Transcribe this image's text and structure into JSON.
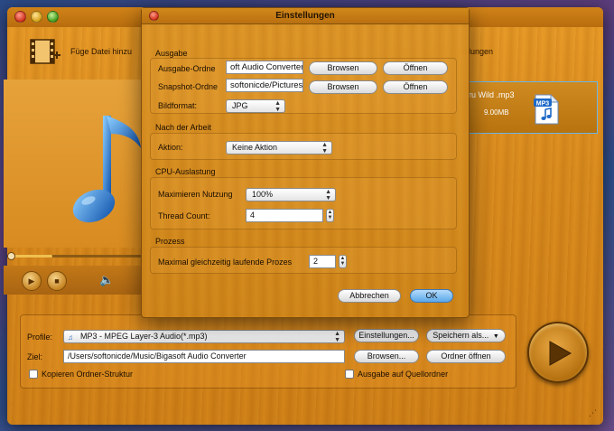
{
  "toolbar": {
    "add_file_label": "Füge Datei hinzu",
    "right_label": "ellungen"
  },
  "file_list": {
    "rows": [
      {
        "name": "..ru Wild .mp3",
        "size": "9.00MB",
        "type_icon": "MP3"
      }
    ]
  },
  "bottom": {
    "profile_label": "Profile:",
    "profile_value": "MP3 - MPEG Layer-3 Audio(*.mp3)",
    "settings_button": "Einstellungen...",
    "save_as_button": "Speichern als...",
    "target_label": "Ziel:",
    "target_value": "/Users/softonicde/Music/Bigasoft Audio Converter",
    "browse_button": "Browsen...",
    "open_folder_button": "Ordner öffnen",
    "copy_structure_label": "Kopieren Ordner-Struktur",
    "output_source_label": "Ausgabe auf Quellordner"
  },
  "dialog": {
    "title": "Einstellungen",
    "output": {
      "section_title": "Ausgabe",
      "output_folder_label": "Ausgabe-Ordne",
      "output_folder_value": "oft Audio Converter",
      "snapshot_folder_label": "Snapshot-Ordne",
      "snapshot_folder_value": "softonicde/Pictures",
      "browse_button": "Browsen",
      "open_button": "Öffnen",
      "image_format_label": "Bildformat:",
      "image_format_value": "JPG"
    },
    "after_work": {
      "section_title": "Nach der Arbeit",
      "action_label": "Aktion:",
      "action_value": "Keine Aktion"
    },
    "cpu": {
      "section_title": "CPU-Auslastung",
      "max_usage_label": "Maximieren Nutzung",
      "max_usage_value": "100%",
      "thread_count_label": "Thread Count:",
      "thread_count_value": "4"
    },
    "process": {
      "section_title": "Prozess",
      "max_parallel_label": "Maximal gleichzeitig laufende Prozes",
      "max_parallel_value": "2"
    },
    "cancel_button": "Abbrechen",
    "ok_button": "OK"
  }
}
